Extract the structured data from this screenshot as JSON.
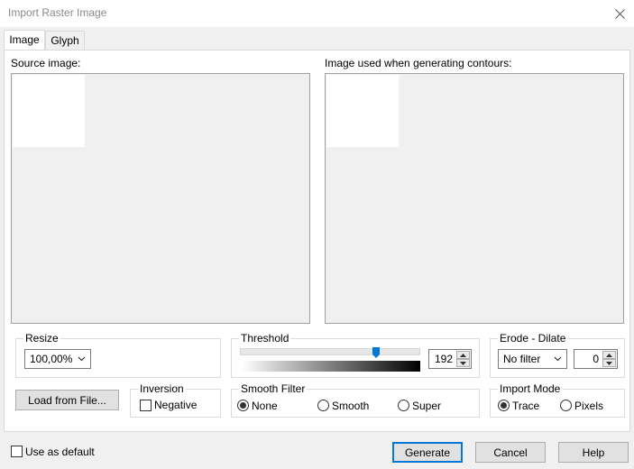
{
  "window": {
    "title": "Import Raster Image"
  },
  "tabs": [
    {
      "label": "Image",
      "active": true
    },
    {
      "label": "Glyph",
      "active": false
    }
  ],
  "source_label": "Source image:",
  "contour_label": "Image used when generating contours:",
  "resize": {
    "title": "Resize",
    "value": "100,00%"
  },
  "threshold": {
    "title": "Threshold",
    "value": "192",
    "max": 255
  },
  "erode_dilate": {
    "title": "Erode - Dilate",
    "filter": "No filter",
    "value": "0"
  },
  "load_button": "Load from File...",
  "inversion": {
    "title": "Inversion",
    "negative_label": "Negative",
    "negative_checked": false
  },
  "smooth_filter": {
    "title": "Smooth Filter",
    "options": [
      "None",
      "Smooth",
      "Super"
    ],
    "selected": "None"
  },
  "import_mode": {
    "title": "Import Mode",
    "options": [
      "Trace",
      "Pixels"
    ],
    "selected": "Trace"
  },
  "footer": {
    "use_default_label": "Use as default",
    "use_default_checked": false,
    "generate": "Generate",
    "cancel": "Cancel",
    "help": "Help"
  },
  "colors": {
    "accent": "#0078d7",
    "preview_bg": "#f0f0f0"
  }
}
